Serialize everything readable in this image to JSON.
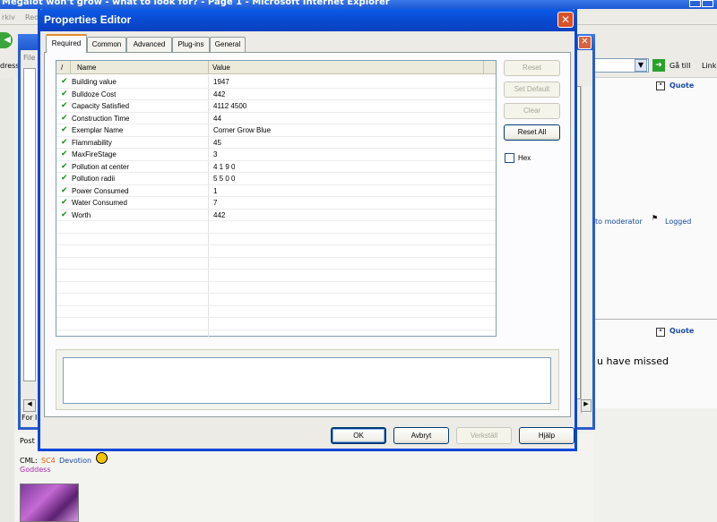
{
  "browser": {
    "title": "Megalot won't grow - what to look for? - Page 1 - Microsoft Internet Explorer",
    "menu": [
      "rkiv",
      "Red"
    ],
    "address_label": "dress",
    "go_label": "Gå till",
    "links_label": "Link",
    "child_window": {
      "file_tab": "File",
      "status_text": "For I"
    }
  },
  "post": {
    "quote_label": "Quote",
    "report_text": "to moderator",
    "logged_label": "Logged",
    "posted_prefix": "Post",
    "missed_text": "u have missed",
    "cml_label": "CML:",
    "sc4_label": "SC4",
    "devotion_label": "Devotion",
    "goddess_label": "Goddess"
  },
  "dialog": {
    "title": "Properties Editor",
    "tabs": [
      {
        "label": "Required",
        "active": true
      },
      {
        "label": "Common",
        "active": false
      },
      {
        "label": "Advanced",
        "active": false
      },
      {
        "label": "Plug-ins",
        "active": false
      },
      {
        "label": "General",
        "active": false
      }
    ],
    "grid": {
      "sort_marker": "/",
      "col_name": "Name",
      "col_value": "Value",
      "rows": [
        {
          "name": "Building value",
          "value": "1947"
        },
        {
          "name": "Bulldoze Cost",
          "value": "442"
        },
        {
          "name": "Capacity Satisfied",
          "value": "4112 4500"
        },
        {
          "name": "Construction Time",
          "value": "44"
        },
        {
          "name": "Exemplar Name",
          "value": "Corner Grow Blue"
        },
        {
          "name": "Flammability",
          "value": "45"
        },
        {
          "name": "MaxFireStage",
          "value": "3"
        },
        {
          "name": "Pollution at center",
          "value": "4 1 9 0"
        },
        {
          "name": "Pollution radii",
          "value": "5 5 0 0"
        },
        {
          "name": "Power Consumed",
          "value": "1"
        },
        {
          "name": "Water Consumed",
          "value": "7"
        },
        {
          "name": "Worth",
          "value": "442"
        }
      ]
    },
    "side_buttons": {
      "reset": "Reset",
      "set_default": "Set Default",
      "clear": "Clear",
      "reset_all": "Reset All"
    },
    "hex_label": "Hex",
    "buttons": {
      "ok": "OK",
      "cancel": "Avbryt",
      "apply": "Verkställ",
      "help": "Hjälp"
    }
  },
  "colors": {
    "title_bar": "#0a4bd2",
    "close_button": "#d8512a",
    "check_mark": "#1c8a1c",
    "active_tab_accent": "#e68b2c"
  }
}
